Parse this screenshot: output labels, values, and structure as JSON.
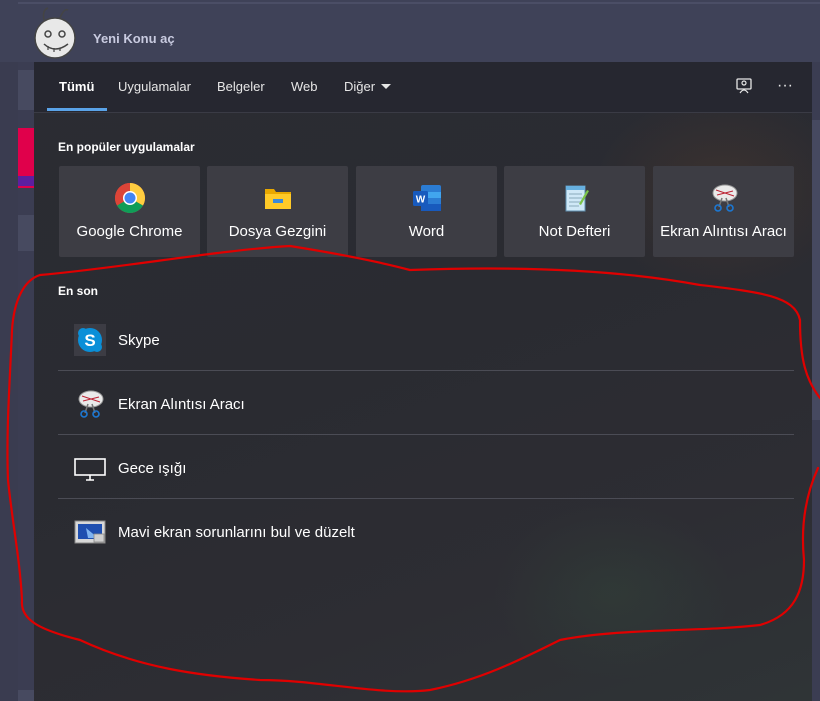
{
  "forum": {
    "title": "Yeni Konu aç"
  },
  "tabs": [
    {
      "label": "Tümü",
      "active": true
    },
    {
      "label": "Uygulamalar",
      "active": false
    },
    {
      "label": "Belgeler",
      "active": false
    },
    {
      "label": "Web",
      "active": false
    },
    {
      "label": "Diğer",
      "active": false
    }
  ],
  "toolbar": {
    "feedback_icon": "feedback-icon",
    "more_icon": "more-icon",
    "more_glyph": "···"
  },
  "popular": {
    "title": "En popüler uygulamalar",
    "apps": [
      {
        "label": "Google Chrome",
        "icon": "chrome-icon"
      },
      {
        "label": "Dosya Gezgini",
        "icon": "folder-icon"
      },
      {
        "label": "Word",
        "icon": "word-icon"
      },
      {
        "label": "Not Defteri",
        "icon": "notepad-icon"
      },
      {
        "label": "Ekran Alıntısı Aracı",
        "icon": "snipping-tool-icon"
      }
    ]
  },
  "recent": {
    "title": "En son",
    "items": [
      {
        "label": "Skype",
        "icon": "skype-icon"
      },
      {
        "label": "Ekran Alıntısı Aracı",
        "icon": "snipping-tool-icon"
      },
      {
        "label": "Gece ışığı",
        "icon": "monitor-icon"
      },
      {
        "label": "Mavi ekran sorunlarını bul ve düzelt",
        "icon": "troubleshoot-icon"
      }
    ]
  },
  "colors": {
    "accent": "#5aa3e8",
    "annotation": "#e00000",
    "tile_bg": "#3d3d44"
  }
}
